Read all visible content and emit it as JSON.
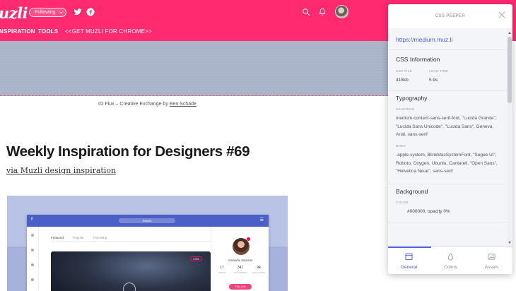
{
  "header": {
    "logo_text": "uzli",
    "follow_label": "Following",
    "nav": [
      "NSPIRATION",
      "TOOLS",
      "<<GET MUZLI FOR CHROME>>"
    ],
    "brand_color": "#ff2a6f",
    "icons": [
      "twitter-icon",
      "facebook-icon",
      "search-icon",
      "bell-icon",
      "avatar"
    ]
  },
  "article": {
    "caption_prefix": "IO Flux – Creative Exchange by ",
    "caption_author": "Ben Schade",
    "title": "Weekly Inspiration for Designers #69",
    "subtitle": "via Muzli design inspiration"
  },
  "mockup": {
    "brand": "f",
    "search_placeholder": "Search",
    "tabs": [
      "Featured",
      "Popular",
      "Following"
    ],
    "live_badge": "LIVE",
    "profile_name": "Amanda Johnson",
    "stats": [
      {
        "value": "17",
        "label": "VIDEOS"
      },
      {
        "value": "347",
        "label": "FOLLOWERS"
      },
      {
        "value": "94",
        "label": "FOLLOWING"
      }
    ],
    "follow_button": "FOLLOW"
  },
  "panel": {
    "title": "CSS PEEPER",
    "url": "https://medium.muz.li",
    "css_info": {
      "title": "CSS Information",
      "file_label": "CSS FILE",
      "file_value": "418kb",
      "time_label": "LOAD TIME",
      "time_value": "5.9s"
    },
    "typography": {
      "title": "Typography",
      "headings_label": "HEADINGS",
      "headings_value": "medium-content-sans-serif-font, \"Lucida Grande\", \"Lucida Sans Unicode\", \"Lucida Sans\", Geneva, Arial, sans-serif",
      "body_label": "BODY",
      "body_value": "-apple-system, BlinkMacSystemFont, \"Segoe UI\", Roboto, Oxygen, Ubuntu, Cantarell, \"Open Sans\", \"Helvetica Neue\", sans-serif"
    },
    "background": {
      "title": "Background",
      "color_label": "COLOR",
      "color_value": "#000000, opacity 0%"
    },
    "tabs": [
      {
        "label": "General",
        "icon": "window-icon",
        "active": true
      },
      {
        "label": "Colors",
        "icon": "drop-icon",
        "active": false
      },
      {
        "label": "Assets",
        "icon": "image-icon",
        "active": false
      }
    ],
    "accent_color": "#4a5fd8"
  }
}
